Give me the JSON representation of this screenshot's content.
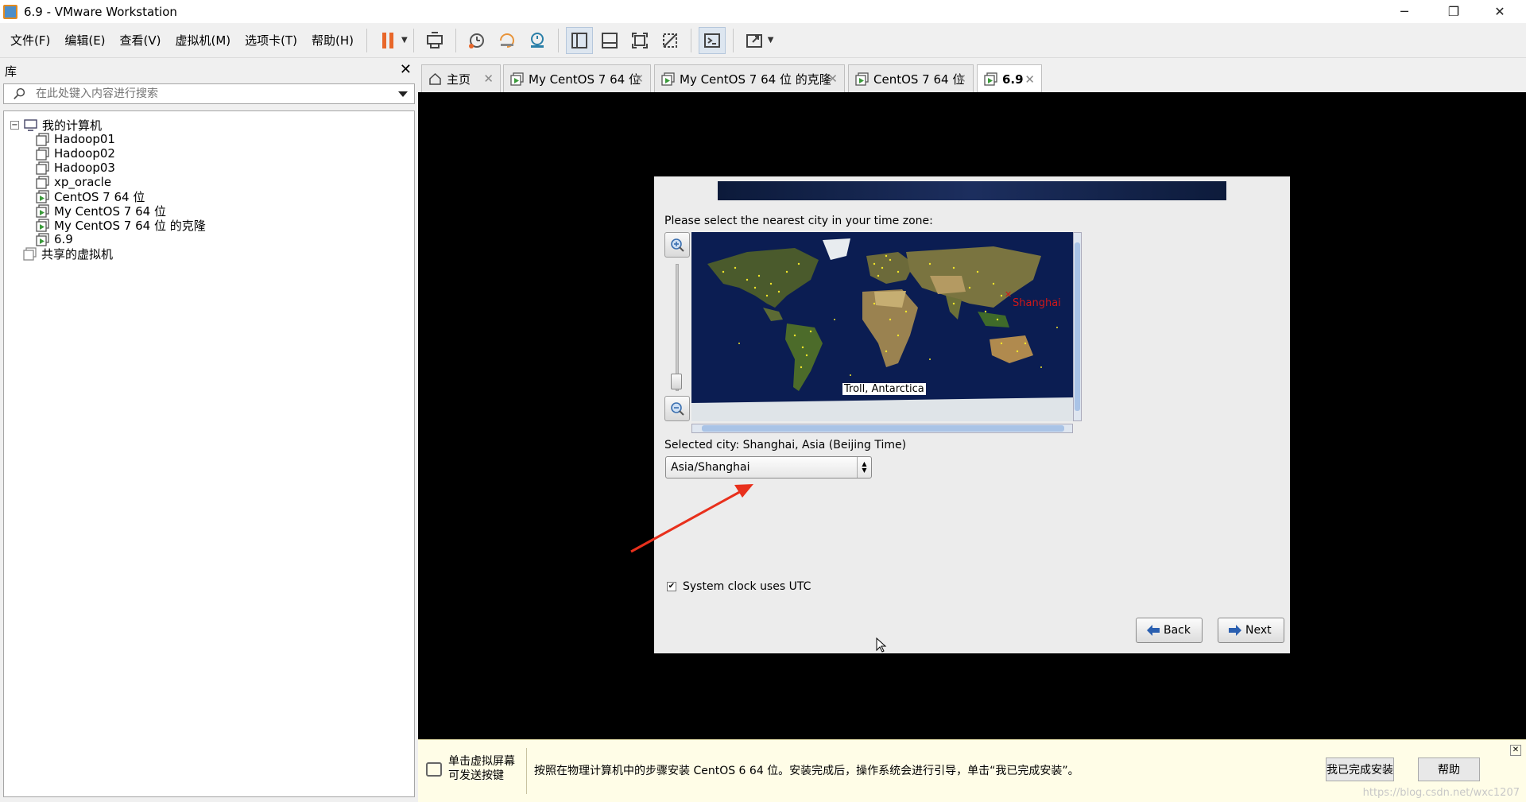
{
  "window": {
    "title": "6.9 - VMware Workstation",
    "controls": [
      "─",
      "❐",
      "✕"
    ]
  },
  "menu": {
    "items": [
      "文件(F)",
      "编辑(E)",
      "查看(V)",
      "虚拟机(M)",
      "选项卡(T)",
      "帮助(H)"
    ]
  },
  "toolbar": {
    "icons": [
      "pause-icon",
      "send-keys-icon",
      "snapshot-icon",
      "revert-snapshot-icon",
      "snapshot-manager-icon",
      "library-view-icon",
      "thumbnail-bar-icon",
      "fullscreen-icon",
      "unity-icon",
      "console-icon",
      "stretch-icon"
    ]
  },
  "library": {
    "title": "库",
    "search_placeholder": "在此处键入内容进行搜索",
    "tree": [
      {
        "label": "我的计算机",
        "level": 0,
        "icon": "computer-icon"
      },
      {
        "label": "Hadoop01",
        "level": 1,
        "icon": "vm-off-icon"
      },
      {
        "label": "Hadoop02",
        "level": 1,
        "icon": "vm-off-icon"
      },
      {
        "label": "Hadoop03",
        "level": 1,
        "icon": "vm-off-icon"
      },
      {
        "label": "xp_oracle",
        "level": 1,
        "icon": "vm-off-icon"
      },
      {
        "label": "CentOS 7 64 位",
        "level": 1,
        "icon": "vm-on-icon"
      },
      {
        "label": "My CentOS 7 64 位",
        "level": 1,
        "icon": "vm-on-icon"
      },
      {
        "label": "My CentOS 7 64 位 的克隆",
        "level": 1,
        "icon": "vm-on-icon"
      },
      {
        "label": "6.9",
        "level": 1,
        "icon": "vm-on-icon"
      },
      {
        "label": "共享的虚拟机",
        "level": 0,
        "icon": "shared-vm-icon"
      }
    ]
  },
  "tabs": [
    {
      "label": "主页",
      "icon": "home-icon",
      "active": false
    },
    {
      "label": "My CentOS 7 64 位",
      "icon": "vm-on-icon",
      "active": false
    },
    {
      "label": "My CentOS 7 64 位 的克隆",
      "icon": "vm-on-icon",
      "active": false
    },
    {
      "label": "CentOS 7 64 位",
      "icon": "vm-on-icon",
      "active": false
    },
    {
      "label": "6.9",
      "icon": "vm-on-icon",
      "active": true
    }
  ],
  "installer": {
    "prompt": "Please select the nearest city in your time zone:",
    "hover_city": "Troll, Antarctica",
    "marked_city": "Shanghai",
    "selected_city_text": "Selected city: Shanghai, Asia (Beijing Time)",
    "timezone_value": "Asia/Shanghai",
    "utc_label": "System clock uses UTC",
    "utc_checked": true,
    "back_label": "Back",
    "next_label": "Next"
  },
  "hint": {
    "left_line1": "单击虚拟屏幕",
    "left_line2": "可发送按键",
    "message": "按照在物理计算机中的步骤安装 CentOS 6 64 位。安装完成后，操作系统会进行引导，单击“我已完成安装”。",
    "done_button": "我已完成安装",
    "help_button": "帮助",
    "watermark": "https://blog.csdn.net/wxc1207"
  }
}
